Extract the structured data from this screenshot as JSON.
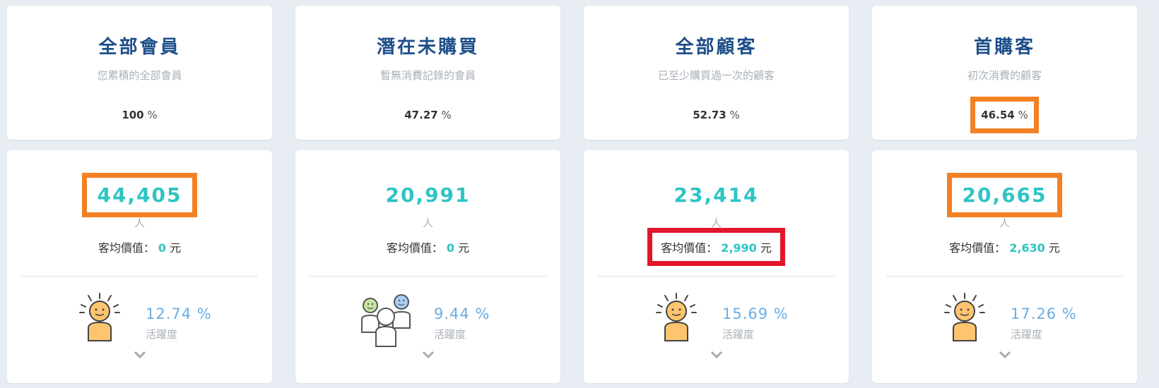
{
  "cards": [
    {
      "title": "全部會員",
      "subtitle": "您累積的全部會員",
      "percent": "100",
      "percent_unit": "%",
      "count": "44,405",
      "count_unit": "人",
      "avg_label": "客均價值：",
      "avg_value": "0",
      "avg_unit": "元",
      "activity_percent": "12.74 %",
      "activity_label": "活躍度",
      "icon": "single-person-icon"
    },
    {
      "title": "潛在未購買",
      "subtitle": "暫無消費記錄的會員",
      "percent": "47.27",
      "percent_unit": "%",
      "count": "20,991",
      "count_unit": "人",
      "avg_label": "客均價值：",
      "avg_value": "0",
      "avg_unit": "元",
      "activity_percent": "9.44 %",
      "activity_label": "活躍度",
      "icon": "group-people-icon"
    },
    {
      "title": "全部顧客",
      "subtitle": "已至少購買過一次的顧客",
      "percent": "52.73",
      "percent_unit": "%",
      "count": "23,414",
      "count_unit": "人",
      "avg_label": "客均價值：",
      "avg_value": "2,990",
      "avg_unit": "元",
      "activity_percent": "15.69 %",
      "activity_label": "活躍度",
      "icon": "single-person-icon"
    },
    {
      "title": "首購客",
      "subtitle": "初次消費的顧客",
      "percent": "46.54",
      "percent_unit": "%",
      "count": "20,665",
      "count_unit": "人",
      "avg_label": "客均價值：",
      "avg_value": "2,630",
      "avg_unit": "元",
      "activity_percent": "17.26 %",
      "activity_label": "活躍度",
      "icon": "single-person-icon"
    }
  ],
  "colors": {
    "title": "#1d4f8a",
    "count": "#2ec4c4",
    "activity": "#6aaee4",
    "highlight_orange": "#f48024",
    "highlight_red": "#e3162a"
  }
}
